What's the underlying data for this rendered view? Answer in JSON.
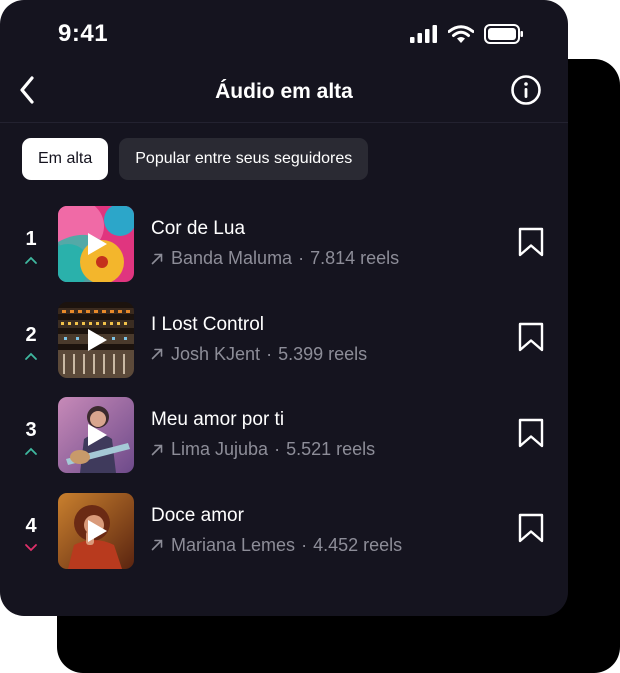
{
  "status_bar": {
    "time": "9:41"
  },
  "header": {
    "title": "Áudio em alta",
    "back_icon": "chevron-left-icon",
    "info_icon": "info-circle-icon"
  },
  "tabs": [
    {
      "label": "Em alta",
      "active": true
    },
    {
      "label": "Popular entre seus seguidores",
      "active": false
    }
  ],
  "tracks": [
    {
      "rank": "1",
      "trend": "up",
      "title": "Cor de Lua",
      "artist": "Banda Maluma",
      "separator": "·",
      "reels": "7.814 reels"
    },
    {
      "rank": "2",
      "trend": "up",
      "title": "I Lost Control",
      "artist": "Josh KJent",
      "separator": "·",
      "reels": "5.399 reels"
    },
    {
      "rank": "3",
      "trend": "up",
      "title": "Meu amor por ti",
      "artist": "Lima Jujuba",
      "separator": "·",
      "reels": "5.521 reels"
    },
    {
      "rank": "4",
      "trend": "down",
      "title": "Doce amor",
      "artist": "Mariana Lemes",
      "separator": "·",
      "reels": "4.452 reels"
    }
  ],
  "colors": {
    "background": "#15141f",
    "trend_up": "#3fb89f",
    "trend_down": "#e0306a",
    "muted_text": "#8d8d98"
  }
}
